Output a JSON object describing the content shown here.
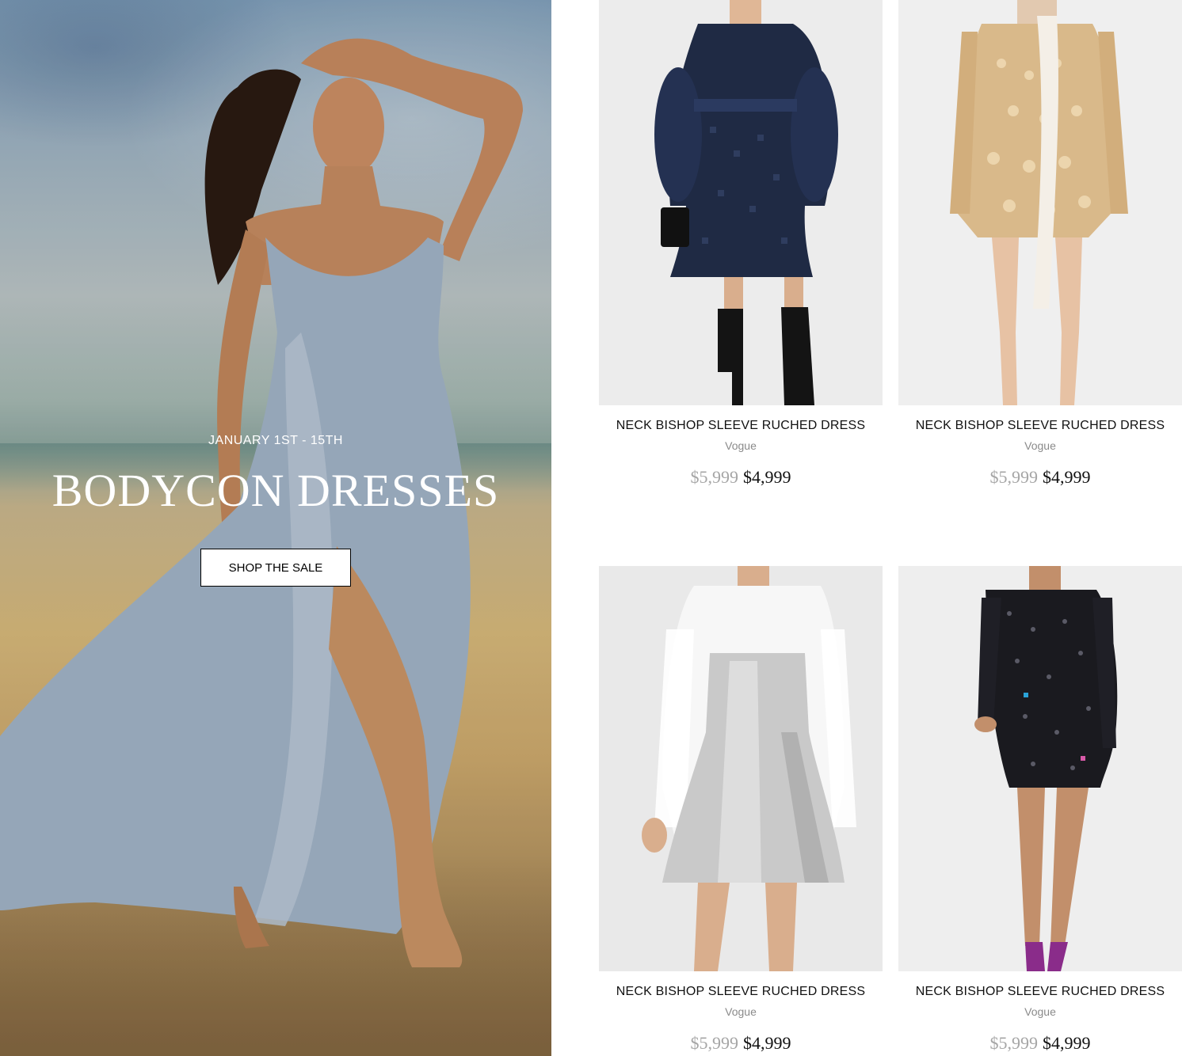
{
  "hero": {
    "date_range": "JANUARY 1ST - 15TH",
    "title": "BODYCON DRESSES",
    "button_label": "SHOP THE SALE"
  },
  "products": [
    {
      "name": "NECK BISHOP SLEEVE RUCHED DRESS",
      "brand": "Vogue",
      "old_price": "$5,999",
      "price": "$4,999",
      "image_desc": "navy-lace-dress"
    },
    {
      "name": "NECK BISHOP SLEEVE RUCHED DRESS",
      "brand": "Vogue",
      "old_price": "$5,999",
      "price": "$4,999",
      "image_desc": "gold-sequin-dress"
    },
    {
      "name": "NECK BISHOP SLEEVE RUCHED DRESS",
      "brand": "Vogue",
      "old_price": "$5,999",
      "price": "$4,999",
      "image_desc": "silver-metallic-dress"
    },
    {
      "name": "NECK BISHOP SLEEVE RUCHED DRESS",
      "brand": "Vogue",
      "old_price": "$5,999",
      "price": "$4,999",
      "image_desc": "black-sequin-dress"
    }
  ],
  "colors": {
    "old_price": "#a6a6a6",
    "brand_text": "#8a8a8a",
    "text": "#111111",
    "hero_text": "#ffffff",
    "dress_navy": "#1f2a44",
    "dress_gold": "#d9b98a",
    "dress_silver": "#c9c9c9",
    "dress_black": "#1a1a1f",
    "hero_dress": "#9fb1c4"
  }
}
